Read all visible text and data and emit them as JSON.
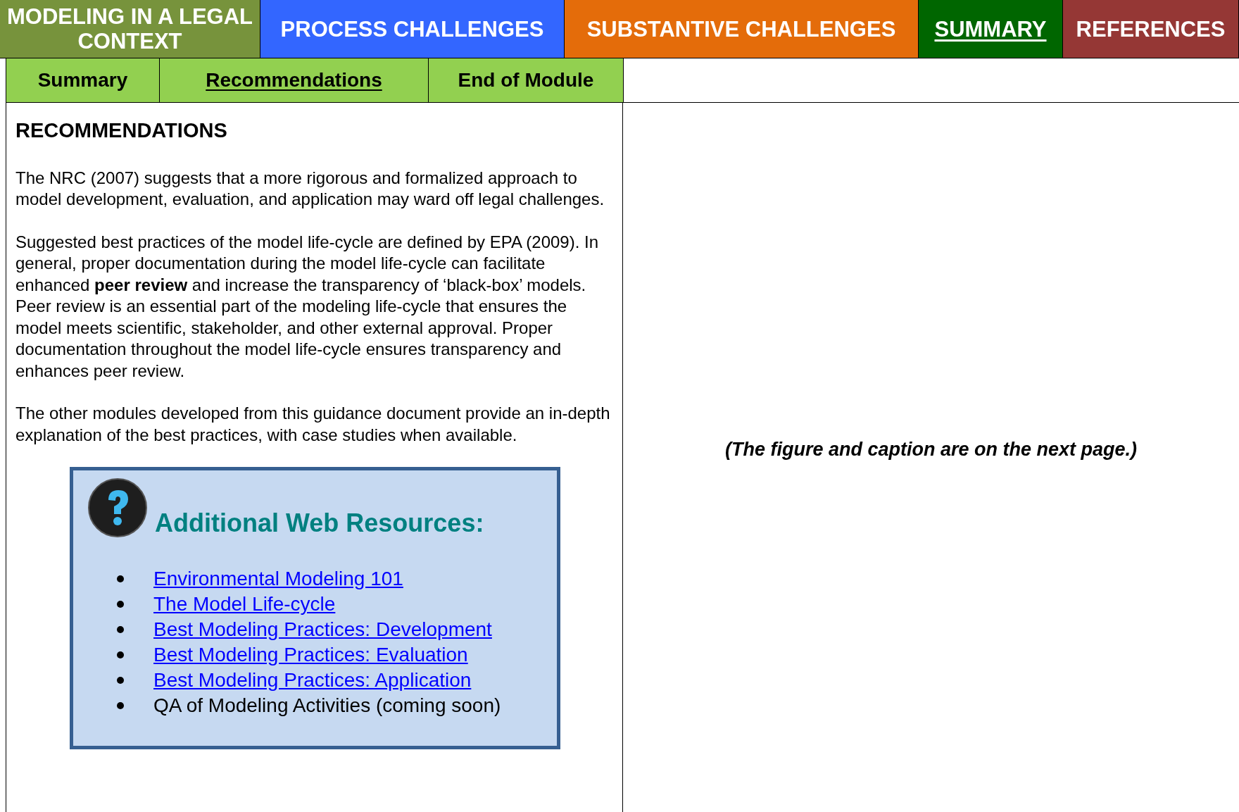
{
  "top_tabs": [
    {
      "label": "MODELING IN A LEGAL CONTEXT",
      "color": "#77933c",
      "selected": false
    },
    {
      "label": "PROCESS CHALLENGES",
      "color": "#3366ff",
      "selected": false
    },
    {
      "label": "SUBSTANTIVE CHALLENGES",
      "color": "#e46c0a",
      "selected": false
    },
    {
      "label": "SUMMARY",
      "color": "#006600",
      "selected": true
    },
    {
      "label": "REFERENCES",
      "color": "#953735",
      "selected": false
    }
  ],
  "sub_tabs": [
    {
      "label": "Summary",
      "selected": false
    },
    {
      "label": "Recommendations",
      "selected": true
    },
    {
      "label": "End of Module",
      "selected": false
    }
  ],
  "content": {
    "heading": "RECOMMENDATIONS",
    "paragraphs": [
      "The NRC (2007) suggests that a more rigorous and formalized approach to model development, evaluation, and application may ward off legal challenges.",
      "Suggested best practices of the model life-cycle are defined by EPA (2009). In general, proper documentation during the model life-cycle can facilitate enhanced **peer review** and increase the transparency of ‘black-box’ models. Peer review is an essential part of the modeling life-cycle that ensures the model meets scientific, stakeholder, and other external approval. Proper documentation throughout the model life-cycle ensures transparency and enhances peer review.",
      "The other modules developed from this guidance document provide an in-depth explanation of the best practices, with case studies when available."
    ],
    "resources": {
      "title": "Additional Web Resources:",
      "items": [
        {
          "kind": "link",
          "text": "Environmental Modeling 101"
        },
        {
          "kind": "link",
          "text": "The Model Life-cycle"
        },
        {
          "kind": "link",
          "text": "Best Modeling Practices: Development"
        },
        {
          "kind": "link",
          "text": "Best Modeling Practices: Evaluation"
        },
        {
          "kind": "link",
          "text": "Best Modeling Practices: Application"
        },
        {
          "kind": "text",
          "text": "QA of Modeling Activities (coming soon)"
        }
      ]
    }
  },
  "side_note": "(The figure and caption are on the next page.)"
}
